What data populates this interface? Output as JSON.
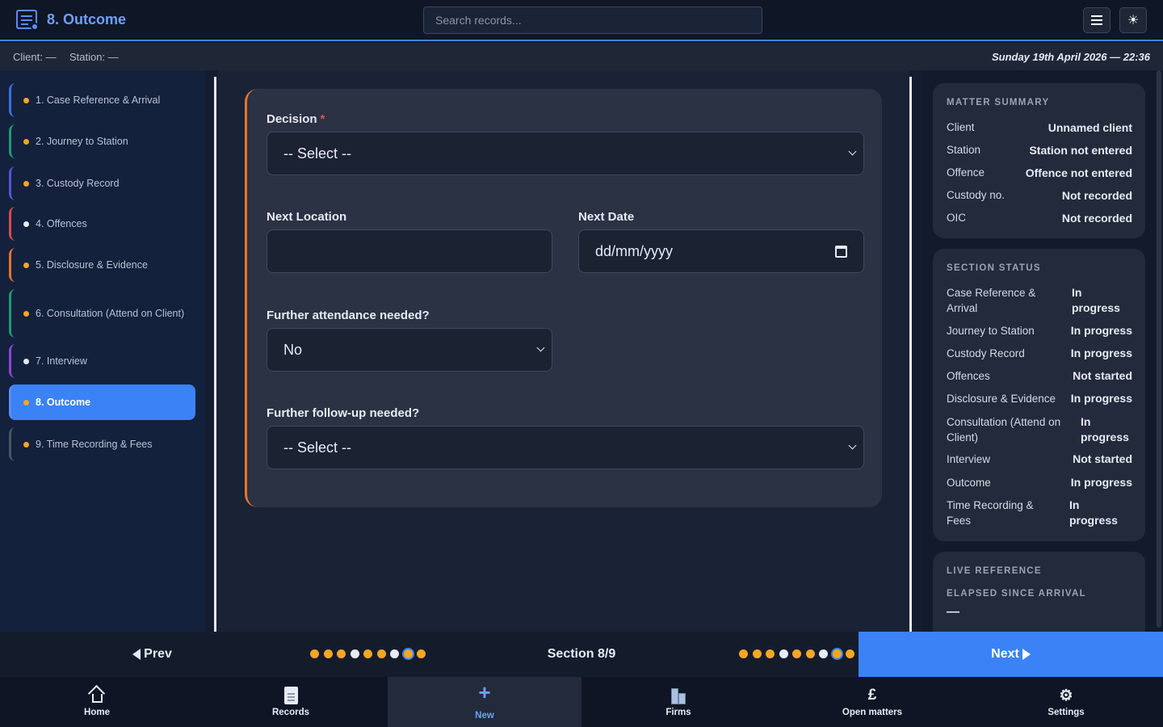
{
  "header": {
    "title": "8. Outcome",
    "search_placeholder": "Search records..."
  },
  "infobar": {
    "client_label": "Client:",
    "client_value": "—",
    "station_label": "Station:",
    "station_value": "—",
    "datetime": "Sunday 19th April 2026 — 22:36"
  },
  "sidebar": {
    "items": [
      {
        "label": "1. Case Reference & Arrival",
        "dot_color": "#f5a623",
        "border_color": "#3b6fe0"
      },
      {
        "label": "2. Journey to Station",
        "dot_color": "#f5a623",
        "border_color": "#1f9d74"
      },
      {
        "label": "3. Custody Record",
        "dot_color": "#f5a623",
        "border_color": "#5a52d6"
      },
      {
        "label": "4. Offences",
        "dot_color": "#e6ebf5",
        "border_color": "#d94a4a"
      },
      {
        "label": "5. Disclosure & Evidence",
        "dot_color": "#f5a623",
        "border_color": "#e8742a"
      },
      {
        "label": "6. Consultation (Attend on Client)",
        "dot_color": "#f5a623",
        "border_color": "#1f9d74"
      },
      {
        "label": "7. Interview",
        "dot_color": "#e6ebf5",
        "border_color": "#8f45d6"
      },
      {
        "label": "8. Outcome",
        "dot_color": "#f5a623",
        "border_color": "#5a8ef2"
      },
      {
        "label": "9. Time Recording & Fees",
        "dot_color": "#f5a623",
        "border_color": "#4b5563"
      }
    ]
  },
  "form": {
    "decision_label": "Decision",
    "decision_required_mark": "*",
    "decision_value": "-- Select --",
    "next_location_label": "Next Location",
    "next_location_value": "",
    "next_date_label": "Next Date",
    "next_date_placeholder": "dd/mm/yyyy",
    "further_attendance_label": "Further attendance needed?",
    "further_attendance_value": "No",
    "further_followup_label": "Further follow-up needed?",
    "further_followup_value": "-- Select --"
  },
  "matter_summary": {
    "title": "MATTER SUMMARY",
    "rows": [
      {
        "key": "Client",
        "value": "Unnamed client"
      },
      {
        "key": "Station",
        "value": "Station not entered"
      },
      {
        "key": "Offence",
        "value": "Offence not entered"
      },
      {
        "key": "Custody no.",
        "value": "Not recorded"
      },
      {
        "key": "OIC",
        "value": "Not recorded"
      }
    ]
  },
  "section_status": {
    "title": "SECTION STATUS",
    "rows": [
      {
        "key": "Case Reference & Arrival",
        "value": "In progress"
      },
      {
        "key": "Journey to Station",
        "value": "In progress"
      },
      {
        "key": "Custody Record",
        "value": "In progress"
      },
      {
        "key": "Offences",
        "value": "Not started"
      },
      {
        "key": "Disclosure & Evidence",
        "value": "In progress"
      },
      {
        "key": "Consultation (Attend on Client)",
        "value": "In progress"
      },
      {
        "key": "Interview",
        "value": "Not started"
      },
      {
        "key": "Outcome",
        "value": "In progress"
      },
      {
        "key": "Time Recording & Fees",
        "value": "In progress"
      }
    ]
  },
  "live_reference": {
    "title": "LIVE REFERENCE",
    "elapsed_label": "ELAPSED SINCE ARRIVAL",
    "elapsed_value": "—"
  },
  "navigation": {
    "prev_label": "Prev",
    "next_label": "Next",
    "section_label": "Section 8/9",
    "progress_dots": [
      "in-progress",
      "in-progress",
      "in-progress",
      "not-started",
      "in-progress",
      "in-progress",
      "not-started",
      "current",
      "in-progress"
    ]
  },
  "tabbar": {
    "home": "Home",
    "records": "Records",
    "new": "New",
    "firms": "Firms",
    "open_matters": "Open matters",
    "settings": "Settings"
  }
}
